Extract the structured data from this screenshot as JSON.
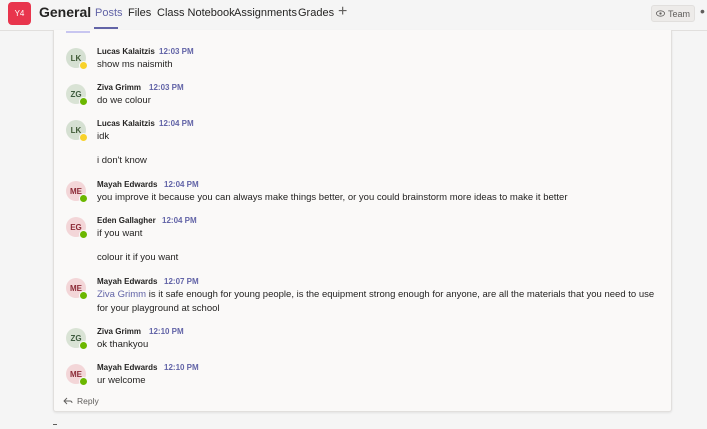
{
  "header": {
    "team_abbrev": "Y4",
    "channel_title": "General",
    "tabs": [
      "Posts",
      "Files",
      "Class Notebook",
      "Assignments",
      "Grades"
    ],
    "add_tab_glyph": "+",
    "team_button_label": "Team",
    "more_glyph": "•"
  },
  "messages": [
    {
      "initials": "LK",
      "author": "Lucas Kalaitzis",
      "time": "12:03 PM",
      "lines": [
        "show ms naismith"
      ],
      "presence": "away"
    },
    {
      "initials": "ZG",
      "author": "Ziva Grimm",
      "time": "12:03 PM",
      "lines": [
        "do we colour"
      ],
      "presence": "online"
    },
    {
      "initials": "LK",
      "author": "Lucas Kalaitzis",
      "time": "12:04 PM",
      "lines": [
        "idk",
        "i don't know"
      ],
      "presence": "away"
    },
    {
      "initials": "ME",
      "author": "Mayah Edwards",
      "time": "12:04 PM",
      "lines": [
        "you improve it because you can always make things better, or you could brainstorm more ideas to make it better"
      ],
      "presence": "online"
    },
    {
      "initials": "EG",
      "author": "Eden Gallagher",
      "time": "12:04 PM",
      "lines": [
        "if you want",
        "colour  it if you want"
      ],
      "presence": "online"
    },
    {
      "initials": "ME",
      "author": "Mayah Edwards",
      "time": "12:07 PM",
      "mention": "Ziva Grimm",
      "lines": [
        " is it safe enough for young people, is the equipment strong enough for anyone, are all the materials that you need to use",
        "for your playground at school"
      ],
      "presence": "online"
    },
    {
      "initials": "ZG",
      "author": "Ziva Grimm",
      "time": "12:10 PM",
      "lines": [
        "ok thankyou"
      ],
      "presence": "online"
    },
    {
      "initials": "ME",
      "author": "Mayah Edwards",
      "time": "12:10 PM",
      "lines": [
        "ur welcome"
      ],
      "presence": "online"
    }
  ],
  "reply_label": "Reply",
  "icons": {
    "team_button": "eye-icon",
    "reply": "reply-arrow-icon",
    "add_tab": "plus-icon"
  },
  "colors": {
    "accent": "#6264a7",
    "team_avatar": "#e8354d",
    "presence_online": "#6bb700",
    "presence_away": "#f8d22a"
  }
}
